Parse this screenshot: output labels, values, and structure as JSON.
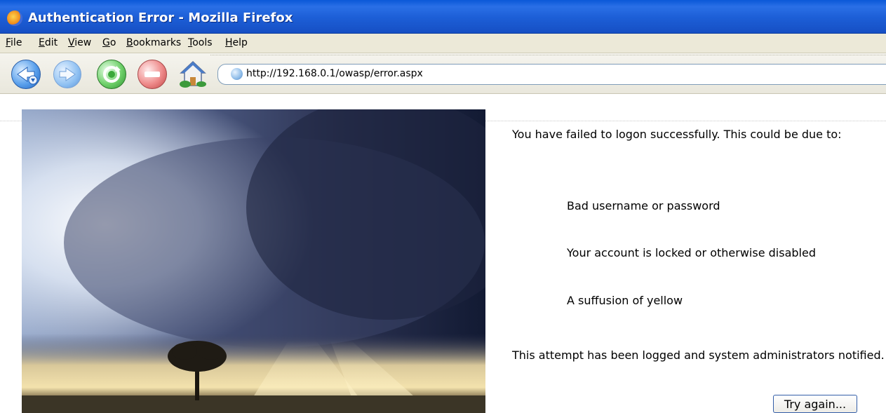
{
  "window": {
    "title": "Authentication Error - Mozilla Firefox"
  },
  "menu": {
    "items": [
      {
        "label": "File",
        "accel": "F",
        "rest": "ile"
      },
      {
        "label": "Edit",
        "accel": "E",
        "rest": "dit"
      },
      {
        "label": "View",
        "accel": "V",
        "rest": "iew"
      },
      {
        "label": "Go",
        "accel": "G",
        "rest": "o"
      },
      {
        "label": "Bookmarks",
        "accel": "B",
        "rest": "ookmarks"
      },
      {
        "label": "Tools",
        "accel": "T",
        "rest": "ools"
      },
      {
        "label": "Help",
        "accel": "H",
        "rest": "elp"
      }
    ]
  },
  "toolbar": {
    "icons": [
      "back-icon",
      "forward-icon",
      "reload-icon",
      "stop-icon",
      "home-icon"
    ]
  },
  "address": {
    "url": "http://192.168.0.1/owasp/error.aspx"
  },
  "content": {
    "image": "storm-cloud-tree-photo",
    "intro": "You have failed to logon successfully. This could be due to:",
    "reasons": [
      "Bad username or password",
      "Your account is locked or otherwise disabled",
      "A suffusion of yellow"
    ],
    "footer": "This attempt has been logged and system administrators notified.",
    "button_label": "Try again..."
  },
  "colors": {
    "titlebar": "#1c5ed6",
    "menubar": "#ece9d8",
    "button_border": "#335ea8"
  }
}
